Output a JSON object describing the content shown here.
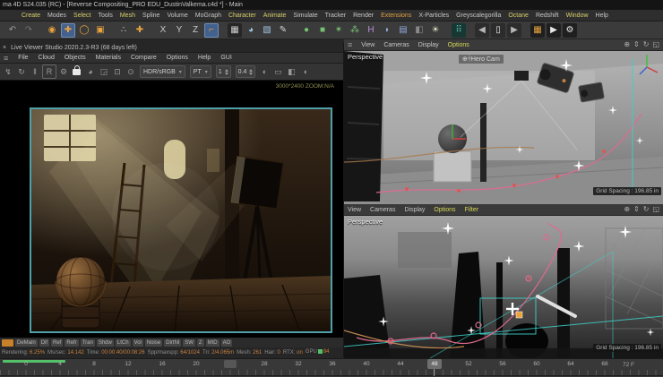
{
  "colors": {
    "accent_orange": "#e8a33d",
    "teal_border": "#4fa0a8",
    "pink_spline": "#e06a8e",
    "teal_grid": "#3fd0c9",
    "green_progress": "#55c06a"
  },
  "title_bar": {
    "title": "ma 4D S24.035 (RC) - [Reverse Compositing_PRO EDU_DustinValkema.c4d *] - Main"
  },
  "menu_bar": {
    "items": [
      {
        "label": "Create",
        "c": "#d8cf6a"
      },
      {
        "label": "Modes",
        "c": "#c6c6c6"
      },
      {
        "label": "Select",
        "c": "#d8cf6a"
      },
      {
        "label": "Tools",
        "c": "#c6c6c6"
      },
      {
        "label": "Mesh",
        "c": "#d8cf6a"
      },
      {
        "label": "Spline",
        "c": "#c6c6c6"
      },
      {
        "label": "Volume",
        "c": "#c6c6c6"
      },
      {
        "label": "MoGraph",
        "c": "#c6c6c6"
      },
      {
        "label": "Character",
        "c": "#d8cf6a"
      },
      {
        "label": "Animate",
        "c": "#d8cf6a"
      },
      {
        "label": "Simulate",
        "c": "#c6c6c6"
      },
      {
        "label": "Tracker",
        "c": "#c6c6c6"
      },
      {
        "label": "Render",
        "c": "#c6c6c6"
      },
      {
        "label": "Extensions",
        "c": "#e0a040"
      },
      {
        "label": "X-Particles",
        "c": "#c6c6c6"
      },
      {
        "label": "Greyscalegorilla",
        "c": "#c6c6c6"
      },
      {
        "label": "Octane",
        "c": "#d8cf6a"
      },
      {
        "label": "Redshift",
        "c": "#c6c6c6"
      },
      {
        "label": "Window",
        "c": "#d8cf6a"
      },
      {
        "label": "Help",
        "c": "#c6c6c6"
      }
    ]
  },
  "main_toolbar": {
    "icons": [
      {
        "name": "undo-icon",
        "g": "↶",
        "c": "#9a9a9a"
      },
      {
        "name": "redo-icon",
        "g": "↷",
        "c": "#6f6f6f"
      },
      {
        "name": "spacer-1",
        "sp": true
      },
      {
        "name": "live-selection-icon",
        "g": "◉",
        "c": "#e8a33d"
      },
      {
        "name": "move-tool-icon",
        "g": "✚",
        "c": "#e8a33d",
        "bg": "#44618e",
        "active": true
      },
      {
        "name": "rotate-tool-icon",
        "g": "◯",
        "c": "#e8a33d"
      },
      {
        "name": "scale-tool-icon",
        "g": "▣",
        "c": "#e8a33d"
      },
      {
        "name": "spacer-2",
        "sp": true
      },
      {
        "name": "last-tool-icon",
        "g": "∴",
        "c": "#cfcfcf"
      },
      {
        "name": "snap-tool-icon",
        "g": "✚",
        "c": "#e8a33d"
      },
      {
        "name": "spacer-3",
        "sp": true
      },
      {
        "name": "axis-x-icon",
        "g": "X",
        "c": "#c9c9c9"
      },
      {
        "name": "axis-y-icon",
        "g": "Y",
        "c": "#c9c9c9"
      },
      {
        "name": "axis-z-icon",
        "g": "Z",
        "c": "#c9c9c9"
      },
      {
        "name": "coord-system-icon",
        "g": "⌐",
        "c": "#e8a33d",
        "bg": "#44618e",
        "active": true
      },
      {
        "name": "spacer-4",
        "sp": true
      },
      {
        "name": "render-view-icon",
        "g": "▦",
        "c": "#cfcfcf",
        "bg": "#262626"
      },
      {
        "name": "team-render-icon",
        "g": "◕",
        "c": "#9fc3e0"
      },
      {
        "name": "content-browser-icon",
        "g": "▧",
        "c": "#9fc3e0"
      },
      {
        "name": "pen-tool-icon",
        "g": "✎",
        "c": "#d8d8d8"
      },
      {
        "name": "spacer-5",
        "sp": true
      },
      {
        "name": "sphere-primitive-icon",
        "g": "●",
        "c": "#74c274"
      },
      {
        "name": "cube-primitive-icon",
        "g": "■",
        "c": "#74c274"
      },
      {
        "name": "star-primitive-icon",
        "g": "✶",
        "c": "#74c274"
      },
      {
        "name": "cluster-primitive-icon",
        "g": "⁂",
        "c": "#74c274"
      },
      {
        "name": "spline-object-icon",
        "g": "H",
        "c": "#b48fd8"
      },
      {
        "name": "metaball-icon",
        "g": "◗",
        "c": "#93a9dc"
      },
      {
        "name": "floor-object-icon",
        "g": "▤",
        "c": "#93a9dc"
      },
      {
        "name": "camera-object-icon",
        "g": "◧",
        "c": "#8a8a8a"
      },
      {
        "name": "light-object-icon",
        "g": "☀",
        "c": "#e6e6c8"
      },
      {
        "name": "spacer-6",
        "sp": true
      },
      {
        "name": "mograph-icon",
        "g": "⠿",
        "c": "#59c2b4",
        "bg": "#173733"
      },
      {
        "name": "spacer-7",
        "sp": true
      },
      {
        "name": "prev-document-icon",
        "g": "◀",
        "c": "#b5b5b5",
        "bg": "#2c2c2c"
      },
      {
        "name": "document-icon",
        "g": "▯",
        "c": "#e8e8e8",
        "bg": "#2c2c2c"
      },
      {
        "name": "next-document-icon",
        "g": "▶",
        "c": "#b5b5b5",
        "bg": "#2c2c2c"
      },
      {
        "name": "spacer-8",
        "sp": true
      },
      {
        "name": "render-active-view-icon",
        "g": "▦",
        "c": "#e8a33d",
        "bg": "#1f1f1f"
      },
      {
        "name": "render-picture-viewer-icon",
        "g": "▶",
        "c": "#e8e8e8",
        "bg": "#1f1f1f"
      },
      {
        "name": "render-settings-icon",
        "g": "⚙",
        "c": "#e8e8e8",
        "bg": "#1f1f1f"
      }
    ]
  },
  "octane": {
    "header": {
      "close": "×",
      "title": "Live Viewer Studio 2020.2.3-R3 (68 days left)"
    },
    "menu": [
      "File",
      "Cloud",
      "Objects",
      "Materials",
      "Compare",
      "Options",
      "Help",
      "GUI"
    ],
    "toolbar": {
      "icons_a": [
        {
          "name": "start-render-icon",
          "g": "↯"
        },
        {
          "name": "sync-render-icon",
          "g": "↻"
        },
        {
          "name": "pause-render-icon",
          "g": "‖"
        },
        {
          "name": "restart-render-icon",
          "g": "R",
          "bd": true
        },
        {
          "name": "kernel-settings-icon",
          "g": "⚙"
        }
      ],
      "icons_b": [
        {
          "name": "clay-mode-icon",
          "g": "◕"
        },
        {
          "name": "pick-material-icon",
          "g": "◲"
        },
        {
          "name": "pick-focus-icon",
          "g": "⊡"
        },
        {
          "name": "region-render-icon",
          "g": "⊙"
        }
      ],
      "icons_c": [
        {
          "name": "background-mode-icon",
          "g": "◐"
        },
        {
          "name": "film-settings-icon",
          "g": "▭"
        },
        {
          "name": "camera-view-icon",
          "g": "◧"
        },
        {
          "name": "subsample-icon",
          "g": "◖"
        }
      ],
      "colorspace": "HDR/sRGB",
      "kernel": "PT",
      "samples": "1",
      "gamma": "0.4"
    },
    "viewport_info": "3000*2400 ZOOM:N/A",
    "passes": [
      "DeMain",
      "Dif",
      "Ref",
      "Refr",
      "Tran",
      "Shdw",
      "LtCh",
      "Vol",
      "Noise",
      "DirtNl",
      "SW",
      "Z",
      "MID",
      "AO"
    ],
    "status": [
      {
        "label": "Rendering:",
        "value": "6.25%"
      },
      {
        "label": "Ms/sec:",
        "value": "14.142"
      },
      {
        "label": "Time:",
        "value": "00:00:40/00:08:26"
      },
      {
        "label": "Spp/maxspp:",
        "value": "64/1024"
      },
      {
        "label": "Tri:",
        "value": "2/4.065m"
      },
      {
        "label": "Mesh:",
        "value": "261"
      },
      {
        "label": "Hair:",
        "value": "0"
      },
      {
        "label": "RTX:",
        "value": "on"
      }
    ],
    "gpu": {
      "label": "GPU",
      "value": "84"
    }
  },
  "viewport_nav": [
    {
      "name": "pan-view-icon",
      "g": "⊕"
    },
    {
      "name": "zoom-view-icon",
      "g": "⇕"
    },
    {
      "name": "rotate-view-icon",
      "g": "↻"
    },
    {
      "name": "maximize-view-icon",
      "g": "◱"
    }
  ],
  "viewports": {
    "top": {
      "menu": [
        {
          "label": "View",
          "c": "#c6c6c6"
        },
        {
          "label": "Cameras",
          "c": "#c6c6c6"
        },
        {
          "label": "Display",
          "c": "#c6c6c6"
        },
        {
          "label": "Options",
          "c": "#d8d85a"
        }
      ],
      "label": "Perspective",
      "camera_label": "Hero Cam",
      "grid_spacing": "Grid Spacing : 196.85 in"
    },
    "bottom": {
      "menu": [
        {
          "label": "View",
          "c": "#c6c6c6"
        },
        {
          "label": "Cameras",
          "c": "#c6c6c6"
        },
        {
          "label": "Display",
          "c": "#c6c6c6"
        },
        {
          "label": "Options",
          "c": "#d8d85a"
        },
        {
          "label": "Filter",
          "c": "#d8d85a"
        }
      ],
      "label": "Perspective",
      "grid_spacing": "Grid Spacing : 196.85 in"
    }
  },
  "timeline": {
    "ticks": [
      "0",
      "4",
      "8",
      "12",
      "16",
      "20",
      "24",
      "28",
      "32",
      "36",
      "40",
      "44",
      "48",
      "52",
      "56",
      "60",
      "64",
      "68"
    ],
    "current_frame": "48",
    "end_label": "72 F"
  }
}
